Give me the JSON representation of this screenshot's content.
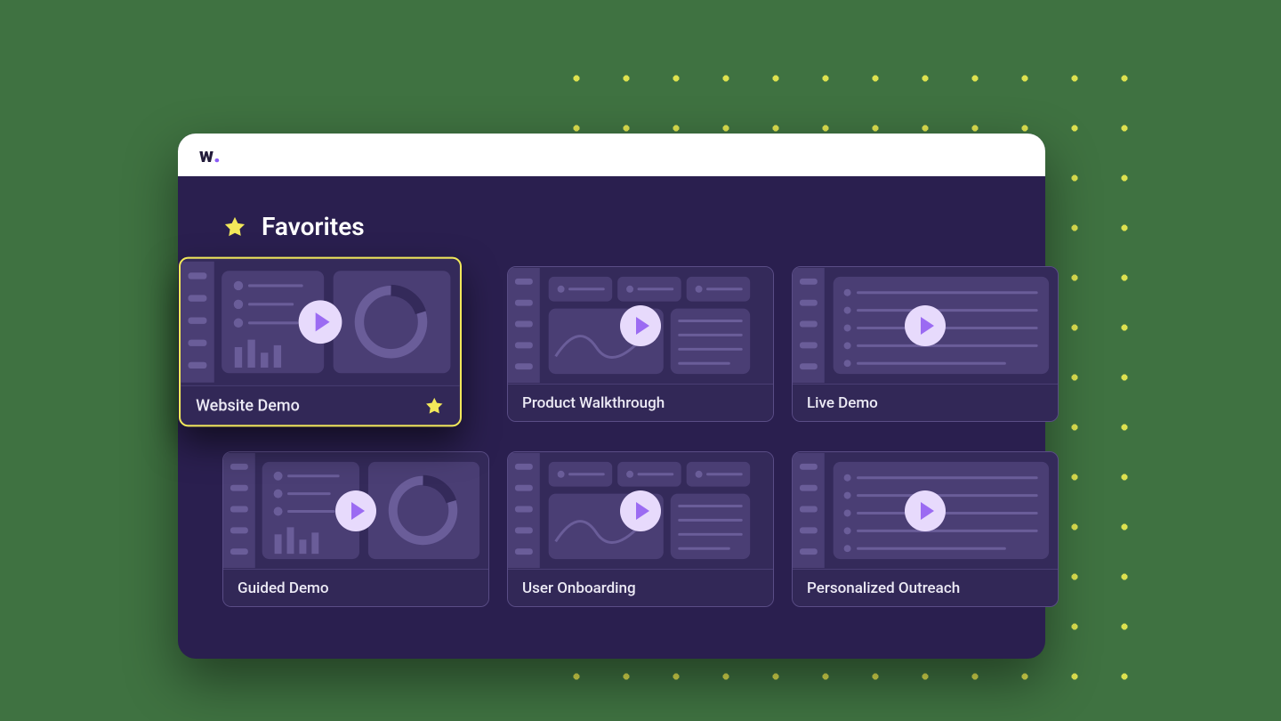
{
  "logo": {
    "text": "w",
    "dot": "."
  },
  "section": {
    "title": "Favorites"
  },
  "cards": [
    {
      "title": "Website Demo",
      "highlighted": true,
      "favorited": true,
      "thumb": "analytics"
    },
    {
      "title": "Product Walkthrough",
      "highlighted": false,
      "favorited": false,
      "thumb": "dashboard"
    },
    {
      "title": "Live Demo",
      "highlighted": false,
      "favorited": false,
      "thumb": "list"
    },
    {
      "title": "Guided Demo",
      "highlighted": false,
      "favorited": false,
      "thumb": "analytics"
    },
    {
      "title": "User Onboarding",
      "highlighted": false,
      "favorited": false,
      "thumb": "dashboard"
    },
    {
      "title": "Personalized Outreach",
      "highlighted": false,
      "favorited": false,
      "thumb": "list"
    }
  ],
  "colors": {
    "accent": "#8b5cf6",
    "highlight": "#f2e85a",
    "panel": "#2a1f4f"
  }
}
